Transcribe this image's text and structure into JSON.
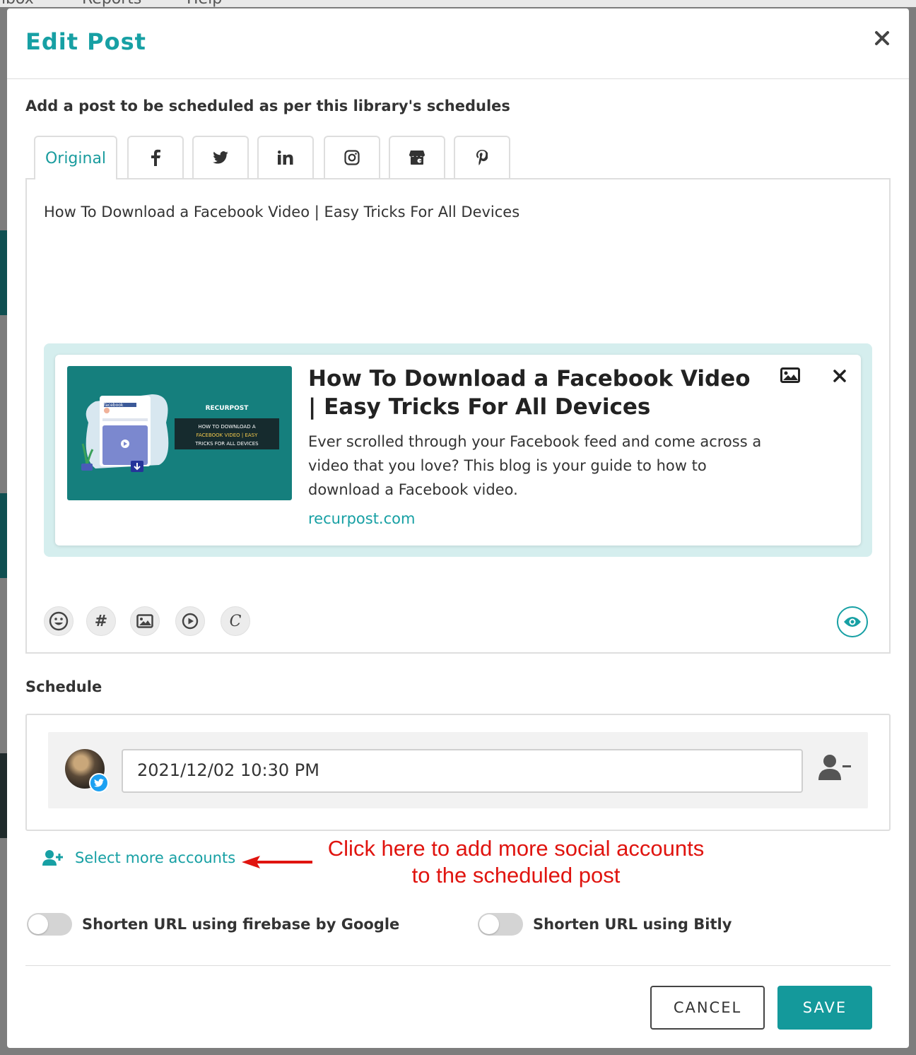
{
  "background": {
    "nav_items": [
      "nbox",
      "Reports",
      "Help"
    ]
  },
  "modal": {
    "title": "Edit Post",
    "close_icon": "close-icon",
    "subtitle": "Add a post to be scheduled as per this library's schedules",
    "tabs": [
      {
        "label": "Original",
        "icon": null,
        "active": true
      },
      {
        "label": "",
        "icon": "facebook-icon"
      },
      {
        "label": "",
        "icon": "twitter-icon"
      },
      {
        "label": "",
        "icon": "linkedin-icon"
      },
      {
        "label": "",
        "icon": "instagram-icon"
      },
      {
        "label": "",
        "icon": "google-business-icon"
      },
      {
        "label": "",
        "icon": "pinterest-icon"
      }
    ],
    "post_text": "How To Download a Facebook Video | Easy Tricks For All Devices",
    "link_preview": {
      "thumbnail": {
        "brand": "RECURPOST",
        "fb_label": "facebook",
        "line1": "HOW TO DOWNLOAD A",
        "line2": "FACEBOOK VIDEO | EASY",
        "line3": "TRICKS FOR ALL DEVICES"
      },
      "title": "How To Download a Facebook Video | Easy Tricks For All Devices",
      "description": "Ever scrolled through your Facebook feed and come across a video that you love? This blog is your guide to how to download a Facebook video.",
      "domain": "recurpost.com"
    },
    "toolbar": {
      "emoji": "emoji-icon",
      "hashtag": "#",
      "image": "image-icon",
      "video": "video-icon",
      "canva": "C",
      "preview": "eye-icon"
    },
    "schedule": {
      "title": "Schedule",
      "datetime": "2021/12/02 10:30 PM",
      "account_network": "twitter"
    },
    "select_more_label": "Select more accounts",
    "annotation": {
      "line1": "Click here to add more social accounts",
      "line2": "to the scheduled post",
      "color": "#e0140f"
    },
    "toggles": [
      {
        "label": "Shorten URL using firebase by Google",
        "on": false
      },
      {
        "label": "Shorten URL using Bitly",
        "on": false
      }
    ],
    "buttons": {
      "cancel": "CANCEL",
      "save": "SAVE"
    },
    "colors": {
      "accent": "#17a0a4",
      "save_bg": "#14999b"
    }
  }
}
